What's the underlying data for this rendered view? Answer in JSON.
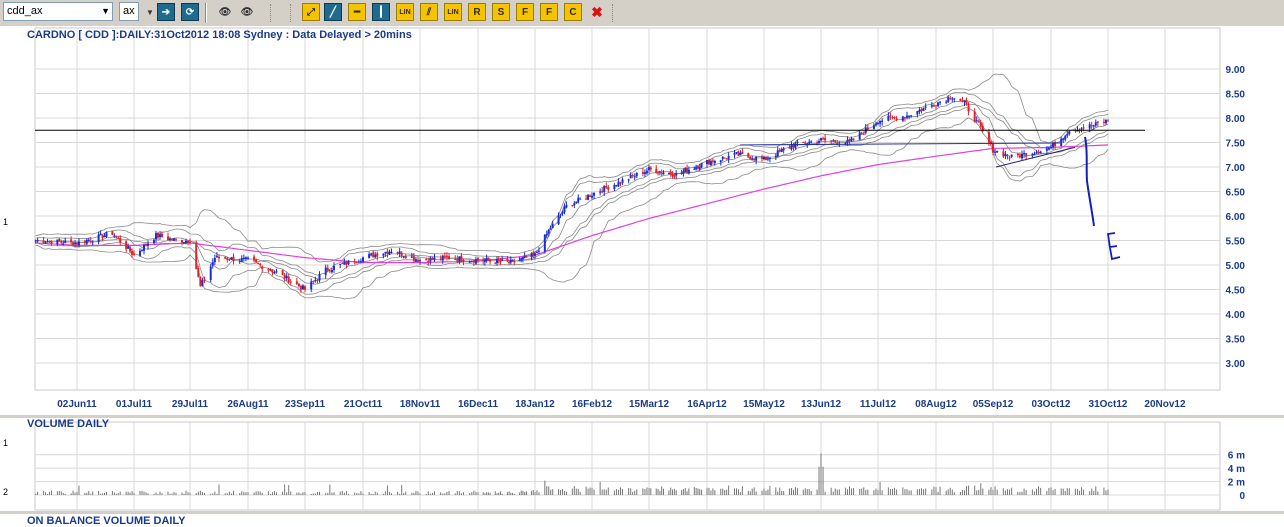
{
  "toolbar": {
    "symbol_value": "cdd_ax",
    "exchange_value": "ax",
    "buttons": [
      {
        "name": "go-forward-button",
        "glyph": "➔",
        "style": "dark"
      },
      {
        "name": "refresh-button",
        "glyph": "⟳",
        "style": "dark"
      },
      {
        "name": "binoculars-icon",
        "glyph": "👁",
        "style": "plain"
      },
      {
        "name": "binoculars-grey-icon",
        "glyph": "👁",
        "style": "plain"
      },
      {
        "name": "draw-trend-button",
        "glyph": "⤢",
        "style": "gold"
      },
      {
        "name": "draw-line-button",
        "glyph": "╱",
        "style": "dark"
      },
      {
        "name": "horizontal-line-button",
        "glyph": "━",
        "style": "gold"
      },
      {
        "name": "vertical-line-button",
        "glyph": "┃",
        "style": "dark"
      },
      {
        "name": "lin-regression-button",
        "glyph": "LIN",
        "style": "gold"
      },
      {
        "name": "parallel-lines-button",
        "glyph": "⫽",
        "style": "gold"
      },
      {
        "name": "lin-channel-button",
        "glyph": "LIN",
        "style": "gold"
      },
      {
        "name": "resistance-button",
        "glyph": "R",
        "style": "gold"
      },
      {
        "name": "support-button",
        "glyph": "S",
        "style": "gold"
      },
      {
        "name": "fib-retracement-button",
        "glyph": "F",
        "style": "gold"
      },
      {
        "name": "fib-extension-button",
        "glyph": "F",
        "style": "gold"
      },
      {
        "name": "cycle-button",
        "glyph": "C",
        "style": "gold"
      },
      {
        "name": "delete-drawing-button",
        "glyph": "✖",
        "style": "delete"
      }
    ]
  },
  "nav": {
    "first": "|◀",
    "prev": "◀",
    "next": "▶",
    "last": "▶|"
  },
  "price_panel": {
    "title": "CARDNO [ CDD ]:DAILY:31Oct2012 18:08 Sydney : Data Delayed > 20mins",
    "left_marker": "1"
  },
  "volume_panel": {
    "title": "VOLUME DAILY",
    "left_markers": [
      "1",
      "2"
    ]
  },
  "obv_panel": {
    "title": "ON BALANCE VOLUME DAILY"
  },
  "colors": {
    "up": "#1a2fd0",
    "down": "#e0202a",
    "ma_long": "#e040e0",
    "bands": "#8a8a8a",
    "grid": "#d8d8d8",
    "annotation": "#1020c0",
    "resistance": "#000000"
  },
  "chart_data": {
    "type": "line",
    "title": "CARDNO [ CDD ]:DAILY:31Oct2012 18:08 Sydney : Data Delayed > 20mins",
    "x_ticks": [
      "02Jun11",
      "01Jul11",
      "29Jul11",
      "26Aug11",
      "23Sep11",
      "21Oct11",
      "18Nov11",
      "16Dec11",
      "18Jan12",
      "16Feb12",
      "15Mar12",
      "16Apr12",
      "15May12",
      "13Jun12",
      "11Jul12",
      "08Aug12",
      "05Sep12",
      "03Oct12",
      "31Oct12",
      "20Nov12"
    ],
    "y_ticks": [
      "3.00",
      "3.50",
      "4.00",
      "4.50",
      "5.00",
      "5.50",
      "6.00",
      "6.50",
      "7.00",
      "7.50",
      "8.00",
      "8.50",
      "9.00"
    ],
    "ylim": [
      2.4,
      9.3
    ],
    "grid": true,
    "series": [
      {
        "name": "Close",
        "x": [
          "12May11",
          "02Jun11",
          "20Jun11",
          "01Jul11",
          "12Jul11",
          "22Jul11",
          "29Jul11",
          "03Aug11",
          "10Aug11",
          "26Aug11",
          "09Sep11",
          "23Sep11",
          "03Oct11",
          "21Oct11",
          "04Nov11",
          "18Nov11",
          "02Dec11",
          "16Dec11",
          "04Jan12",
          "18Jan12",
          "25Jan12",
          "03Feb12",
          "16Feb12",
          "01Mar12",
          "15Mar12",
          "30Mar12",
          "16Apr12",
          "01May12",
          "15May12",
          "30May12",
          "13Jun12",
          "27Jun12",
          "11Jul12",
          "25Jul12",
          "08Aug12",
          "16Aug12",
          "22Aug12",
          "29Aug12",
          "05Sep12",
          "14Sep12",
          "24Sep12",
          "03Oct12",
          "12Oct12",
          "24Oct12",
          "31Oct12"
        ],
        "y": [
          5.5,
          5.45,
          5.65,
          5.2,
          5.6,
          5.5,
          5.5,
          4.55,
          5.15,
          5.1,
          4.85,
          4.5,
          4.9,
          5.15,
          5.3,
          5.1,
          5.15,
          5.1,
          5.05,
          5.2,
          5.7,
          6.2,
          6.45,
          6.7,
          6.95,
          6.85,
          7.1,
          7.25,
          7.15,
          7.45,
          7.55,
          7.5,
          7.95,
          8.05,
          8.3,
          8.45,
          8.3,
          7.85,
          7.35,
          7.2,
          7.3,
          7.4,
          7.75,
          7.85,
          7.95
        ]
      },
      {
        "name": "Long MA",
        "x": [
          "12May11",
          "02Jun11",
          "01Jul11",
          "29Jul11",
          "26Aug11",
          "23Sep11",
          "21Oct11",
          "18Nov11",
          "16Dec11",
          "18Jan12",
          "16Feb12",
          "15Mar12",
          "16Apr12",
          "15May12",
          "13Jun12",
          "11Jul12",
          "08Aug12",
          "05Sep12",
          "03Oct12",
          "31Oct12"
        ],
        "y": [
          5.45,
          5.4,
          5.4,
          5.45,
          5.3,
          5.15,
          5.05,
          5.05,
          5.08,
          5.2,
          5.6,
          5.95,
          6.25,
          6.55,
          6.82,
          7.05,
          7.22,
          7.38,
          7.4,
          7.45
        ]
      }
    ],
    "horizontal_line": 7.75,
    "volume": {
      "y_ticks": [
        "6 m",
        "4 m",
        "2 m",
        "0"
      ],
      "ylim": [
        0,
        7
      ],
      "spike": {
        "x": "13Jun12",
        "value": 6.2
      }
    }
  }
}
